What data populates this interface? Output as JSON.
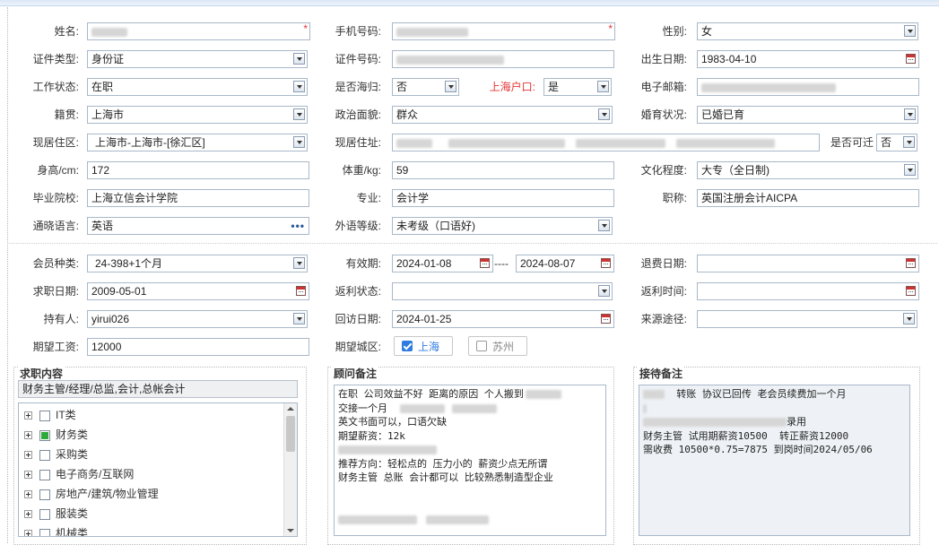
{
  "form": {
    "name_label": "姓名:",
    "phone_label": "手机号码:",
    "gender_label": "性别:",
    "gender_value": "女",
    "idtype_label": "证件类型:",
    "idtype_value": "身份证",
    "idno_label": "证件号码:",
    "birth_label": "出生日期:",
    "birth_value": "1983-04-10",
    "workstatus_label": "工作状态:",
    "workstatus_value": "在职",
    "returnee_label": "是否海归:",
    "returnee_value": "否",
    "hukou_label": "上海户口:",
    "hukou_value": "是",
    "email_label": "电子邮箱:",
    "native_label": "籍贯:",
    "native_value": "上海市",
    "political_label": "政治面貌:",
    "political_value": "群众",
    "marital_label": "婚育状况:",
    "marital_value": "已婚已育",
    "district_label": "现居住区:",
    "district_value": "上海市-上海市-[徐汇区]",
    "address_label": "现居住址:",
    "relocate_label": "是否可迁",
    "relocate_value": "否",
    "height_label": "身高/cm:",
    "height_value": "172",
    "weight_label": "体重/kg:",
    "weight_value": "59",
    "education_label": "文化程度:",
    "education_value": "大专（全日制)",
    "school_label": "毕业院校:",
    "school_value": "上海立信会计学院",
    "major_label": "专业:",
    "major_value": "会计学",
    "title_label": "职称:",
    "title_value": "英国注册会计AICPA",
    "language_label": "通晓语言:",
    "language_value": "英语",
    "language_more": "•••",
    "foreign_label": "外语等级:",
    "foreign_value": "未考级（口语好)"
  },
  "member": {
    "type_label": "会员种类:",
    "type_value": "24-398+1个月",
    "valid_label": "有效期:",
    "valid_from": "2024-01-08",
    "valid_sep": "----",
    "valid_to": "2024-08-07",
    "refund_label": "退费日期:",
    "jobdate_label": "求职日期:",
    "jobdate_value": "2009-05-01",
    "rebate_status_label": "返利状态:",
    "rebate_time_label": "返利时间:",
    "holder_label": "持有人:",
    "holder_value": "yirui026",
    "visit_label": "回访日期:",
    "visit_value": "2024-01-25",
    "source_label": "来源途径:",
    "salary_label": "期望工资:",
    "salary_value": "12000",
    "city_label": "期望城区:",
    "city_options": [
      {
        "label": "上海",
        "checked": true
      },
      {
        "label": "苏州",
        "checked": false
      }
    ]
  },
  "job_panel": {
    "title": "求职内容",
    "summary": "财务主管/经理/总监,会计,总帐会计",
    "tree": [
      "IT类",
      "财务类",
      "采购类",
      "电子商务/互联网",
      "房地产/建筑/物业管理",
      "服装类",
      "机械类"
    ]
  },
  "advisor_panel": {
    "title": "顾问备注",
    "lines": [
      "在职 公司效益不好 距离的原因 个人搬到",
      "交接一个月",
      "英文书面可以，口语欠缺",
      "期望薪资：12k",
      "",
      "推荐方向：轻松点的 压力小的 薪资少点无所谓",
      "财务主管 总账 会计都可以 比较熟悉制造型企业"
    ]
  },
  "reception_panel": {
    "title": "接待备注",
    "lines": [
      "  转账 协议已回传 老会员续费加一个月",
      "",
      "录用",
      "财务主管 试用期薪资10500  转正薪资12000",
      "需收费 10500*0.75=7875 到岗时间2024/05/06"
    ]
  },
  "colors": {
    "accent": "#2f7be0",
    "required": "#e53333",
    "border": "#a9b8c9"
  }
}
